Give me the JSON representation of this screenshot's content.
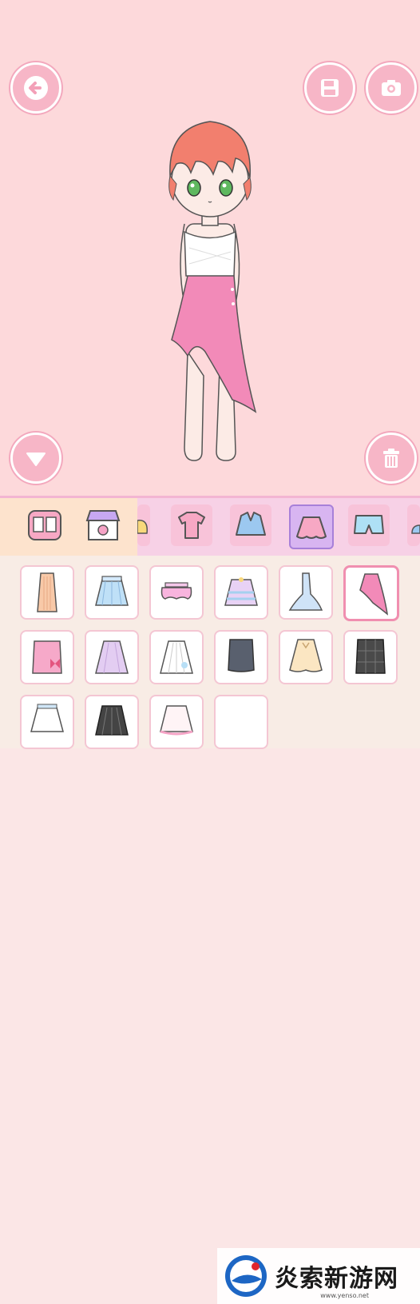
{
  "stage": {
    "background": "#fdd9db",
    "buttons": [
      {
        "icon": "back-arrow-icon"
      },
      {
        "icon": "save-icon"
      },
      {
        "icon": "camera-icon"
      },
      {
        "icon": "down-arrow-icon"
      },
      {
        "icon": "trash-icon"
      }
    ]
  },
  "character": {
    "hair_color": "#f27f6e",
    "eye_color": "#5fb85f",
    "top": "white bandeau top",
    "skirt": "pink asymmetric ruffle skirt",
    "skirt_color": "#f28ab8"
  },
  "toolbar": {
    "left_icons": [
      "wardrobe-icon",
      "shop-icon"
    ],
    "categories": [
      "hair-category-icon",
      "shirt-category-icon",
      "jacket-category-icon",
      "skirt-category-icon",
      "shorts-category-icon",
      "shoes-category-icon"
    ],
    "selected": "skirt-category-icon"
  },
  "items": [
    {
      "name": "long-peach-skirt",
      "color": "#f8c9a8",
      "selected": false
    },
    {
      "name": "blue-pleated-skirt",
      "color": "#bfe0f7",
      "selected": false
    },
    {
      "name": "pink-tutu-skirt",
      "color": "#f5c7ea",
      "selected": false
    },
    {
      "name": "pastel-layered-skirt",
      "color": "#e8d2f5",
      "selected": false
    },
    {
      "name": "blue-mermaid-skirt",
      "color": "#cfe3f7",
      "selected": false
    },
    {
      "name": "pink-asymmetric-skirt",
      "color": "#f28ab8",
      "selected": true
    },
    {
      "name": "pink-bow-skirt",
      "color": "#f6a9c9",
      "selected": false
    },
    {
      "name": "lavender-skirt",
      "color": "#e3cdf2",
      "selected": false
    },
    {
      "name": "white-floral-skirt",
      "color": "#ffffff",
      "selected": false
    },
    {
      "name": "grey-pencil-skirt",
      "color": "#59606e",
      "selected": false
    },
    {
      "name": "cream-skirt",
      "color": "#fbe6c2",
      "selected": false
    },
    {
      "name": "black-plaid-skirt",
      "color": "#4a4a4a",
      "selected": false
    },
    {
      "name": "white-ruffle-skirt",
      "color": "#ffffff",
      "selected": false
    },
    {
      "name": "black-pleated-skirt",
      "color": "#444444",
      "selected": false
    },
    {
      "name": "white-pink-skirt",
      "color": "#fff4f6",
      "selected": false
    }
  ],
  "watermark": {
    "text": "炎索新游网",
    "url": "www.yenso.net"
  }
}
